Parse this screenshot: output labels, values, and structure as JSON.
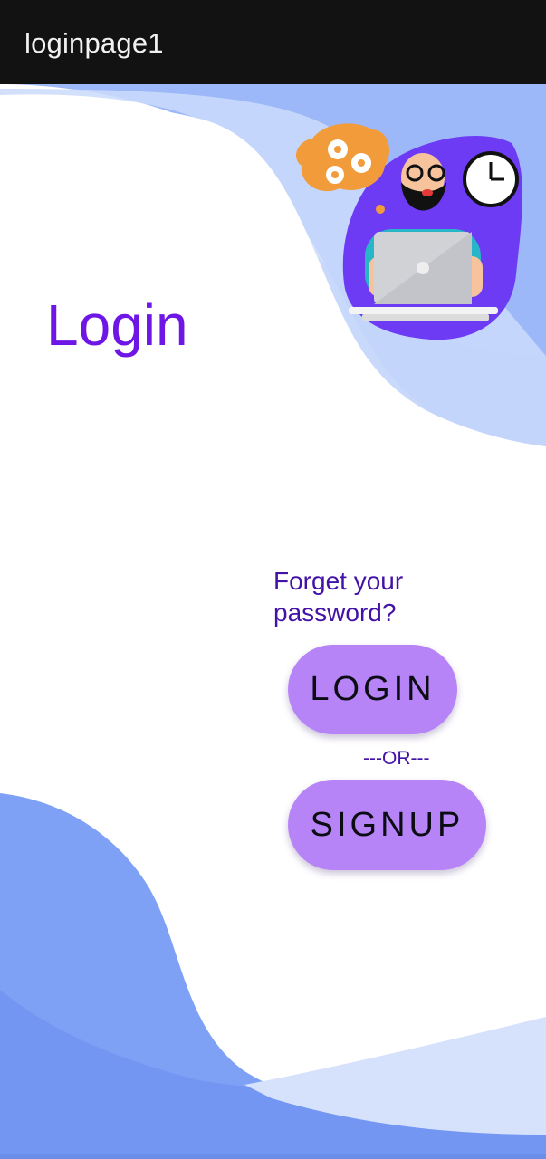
{
  "app": {
    "title": "loginpage1"
  },
  "main": {
    "heading": "Login",
    "forgot_password": "Forget your password?",
    "login_button": "LOGIN",
    "separator": "---OR---",
    "signup_button": "SIGNUP"
  },
  "colors": {
    "appbar_bg": "#121212",
    "heading": "#6e16e6",
    "link_text": "#4312a6",
    "button_bg": "#b784f8",
    "wave_dark": "#7ea1f5",
    "wave_mid": "#9ebaf8",
    "wave_light": "#cedcfb"
  },
  "icons": [
    "gear-icon",
    "clock-icon",
    "laptop-icon",
    "person-illustration"
  ]
}
